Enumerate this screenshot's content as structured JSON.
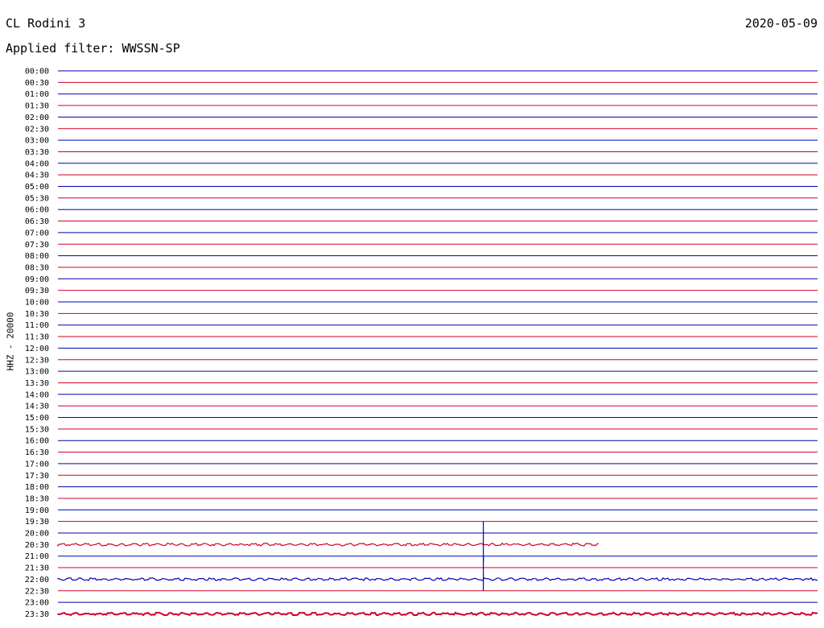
{
  "header": {
    "station": "CL Rodini 3",
    "date": "2020-05-09",
    "filter_label": "Applied filter: WWSSN-SP"
  },
  "chart_data": {
    "type": "line",
    "title": "CL Rodini 3",
    "ylabel": "HHZ - 20000",
    "grid": false,
    "colors": [
      "#0000b0",
      "#d0002a"
    ],
    "rows": [
      "00:00",
      "00:30",
      "01:00",
      "01:30",
      "02:00",
      "02:30",
      "03:00",
      "03:30",
      "04:00",
      "04:30",
      "05:00",
      "05:30",
      "06:00",
      "06:30",
      "07:00",
      "07:30",
      "08:00",
      "08:30",
      "09:00",
      "09:30",
      "10:00",
      "10:30",
      "11:00",
      "11:30",
      "12:00",
      "12:30",
      "13:00",
      "13:30",
      "14:00",
      "14:30",
      "15:00",
      "15:30",
      "16:00",
      "16:30",
      "17:00",
      "17:30",
      "18:00",
      "18:30",
      "19:00",
      "19:30",
      "20:00",
      "20:30",
      "21:00",
      "21:30",
      "22:00",
      "22:30",
      "23:00",
      "23:30"
    ],
    "events": [
      {
        "row": "19:30",
        "minute": 16.8,
        "amplitude_rows": 3.5,
        "direction": "down"
      },
      {
        "row": "21:00",
        "minute": 16.8,
        "amplitude_rows": 3.0,
        "direction": "down"
      }
    ],
    "noisy_rows": [
      "20:30",
      "22:00",
      "23:30"
    ],
    "trace_end_minute": {
      "20:30": 21.4
    }
  }
}
